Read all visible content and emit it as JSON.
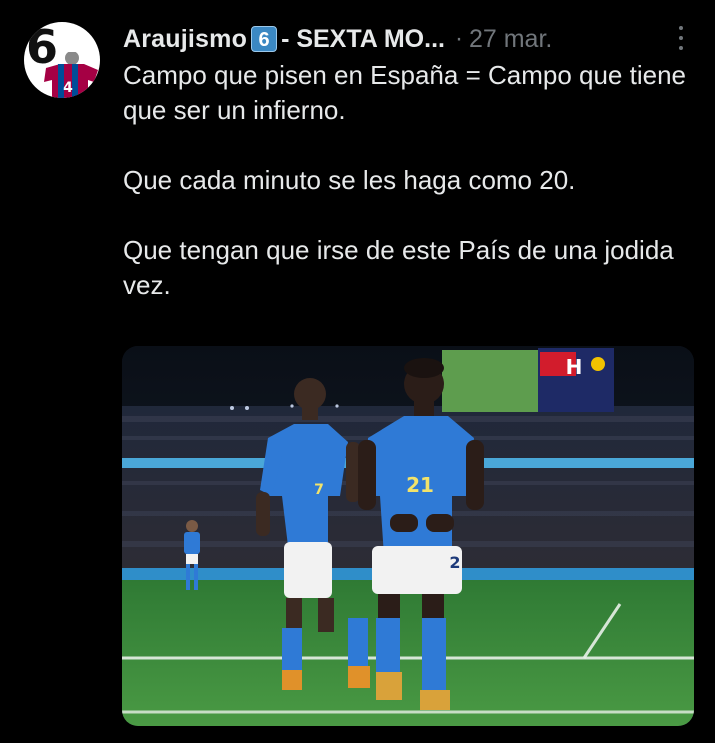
{
  "tweet": {
    "author_name": "Araujismo",
    "badge": "6",
    "handle_suffix": "- SEXTA MO...",
    "separator": "·",
    "time": "27 mar.",
    "text_lines": [
      "Campo que pisen en España = Campo que tiene que ser un infierno.",
      "Que cada minuto se les haga como 20.",
      "Que tengan que irse de este País de una jodida vez."
    ],
    "media": {
      "player_left_number": "7",
      "player_right_number": "21",
      "player_far_right_number": "2"
    }
  },
  "colors": {
    "background": "#000000",
    "primary_text": "#e7e9ea",
    "secondary_text": "#71767b",
    "jersey_blue": "#2f7ad6",
    "pitch_green": "#3e8f3a"
  },
  "icons": {
    "more": "three-dots-vertical"
  }
}
